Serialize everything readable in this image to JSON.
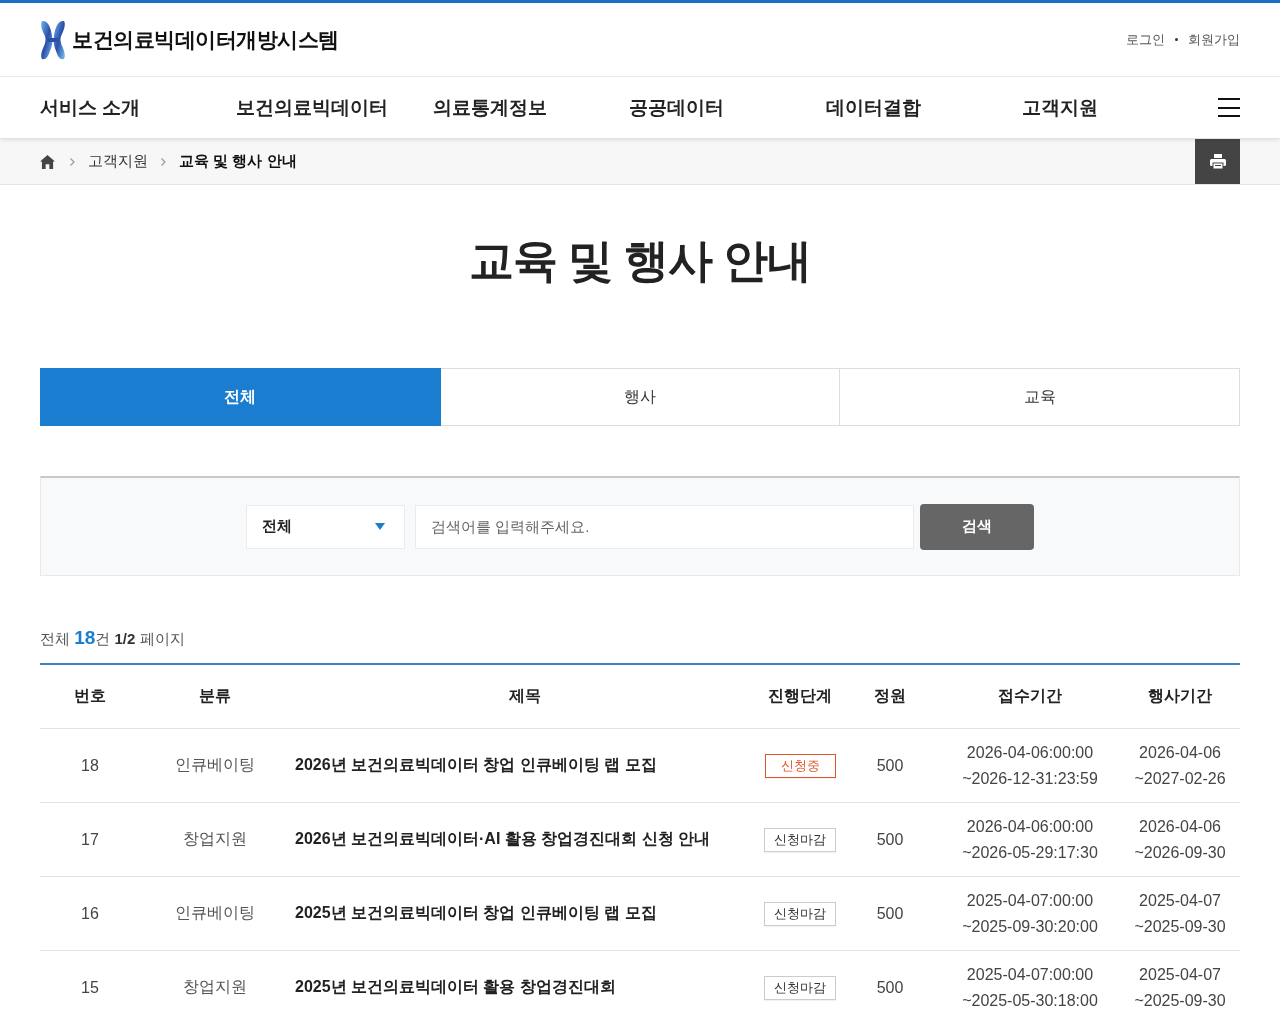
{
  "header": {
    "site_title": "보건의료빅데이터개방시스템",
    "links": [
      "로그인",
      "회원가입"
    ]
  },
  "nav": {
    "items": [
      "서비스 소개",
      "보건의료빅데이터",
      "의료통계정보",
      "공공데이터",
      "데이터결합",
      "고객지원"
    ]
  },
  "breadcrumb": [
    {
      "label": "고객지원",
      "current": false
    },
    {
      "label": "교육 및 행사 안내",
      "current": true
    }
  ],
  "page_title": "교육 및 행사 안내",
  "tabs": [
    {
      "label": "전체",
      "selected": true
    },
    {
      "label": "행사",
      "selected": false
    },
    {
      "label": "교육",
      "selected": false
    }
  ],
  "search": {
    "category": "전체",
    "placeholder": "검색어를 입력해주세요.",
    "button": "검색"
  },
  "results": {
    "label": "전체",
    "total": "18",
    "unit": "건",
    "page": "1/2",
    "page_label": "페이지"
  },
  "table": {
    "columns": [
      "번호",
      "분류",
      "제목",
      "진행단계",
      "정원",
      "접수기간",
      "행사기간"
    ],
    "rows": [
      {
        "no": "18",
        "category": "인큐베이팅",
        "title": "2026년 보건의료빅데이터 창업 인큐베이팅 랩 모집",
        "status": "신청중",
        "accepting": true,
        "capacity": "500",
        "reception": [
          "2026-04-06:00:00",
          "~2026-12-31:23:59"
        ],
        "event": [
          "2026-04-06",
          "~2027-02-26"
        ]
      },
      {
        "no": "17",
        "category": "창업지원",
        "title": "2026년 보건의료빅데이터·AI 활용 창업경진대회 신청 안내",
        "status": "신청마감",
        "accepting": false,
        "capacity": "500",
        "reception": [
          "2026-04-06:00:00",
          "~2026-05-29:17:30"
        ],
        "event": [
          "2026-04-06",
          "~2026-09-30"
        ]
      },
      {
        "no": "16",
        "category": "인큐베이팅",
        "title": "2025년 보건의료빅데이터 창업 인큐베이팅 랩 모집",
        "status": "신청마감",
        "accepting": false,
        "capacity": "500",
        "reception": [
          "2025-04-07:00:00",
          "~2025-09-30:20:00"
        ],
        "event": [
          "2025-04-07",
          "~2025-09-30"
        ]
      },
      {
        "no": "15",
        "category": "창업지원",
        "title": "2025년 보건의료빅데이터 활용 창업경진대회",
        "status": "신청마감",
        "accepting": false,
        "capacity": "500",
        "reception": [
          "2025-04-07:00:00",
          "~2025-05-30:18:00"
        ],
        "event": [
          "2025-04-07",
          "~2025-09-30"
        ]
      }
    ]
  }
}
